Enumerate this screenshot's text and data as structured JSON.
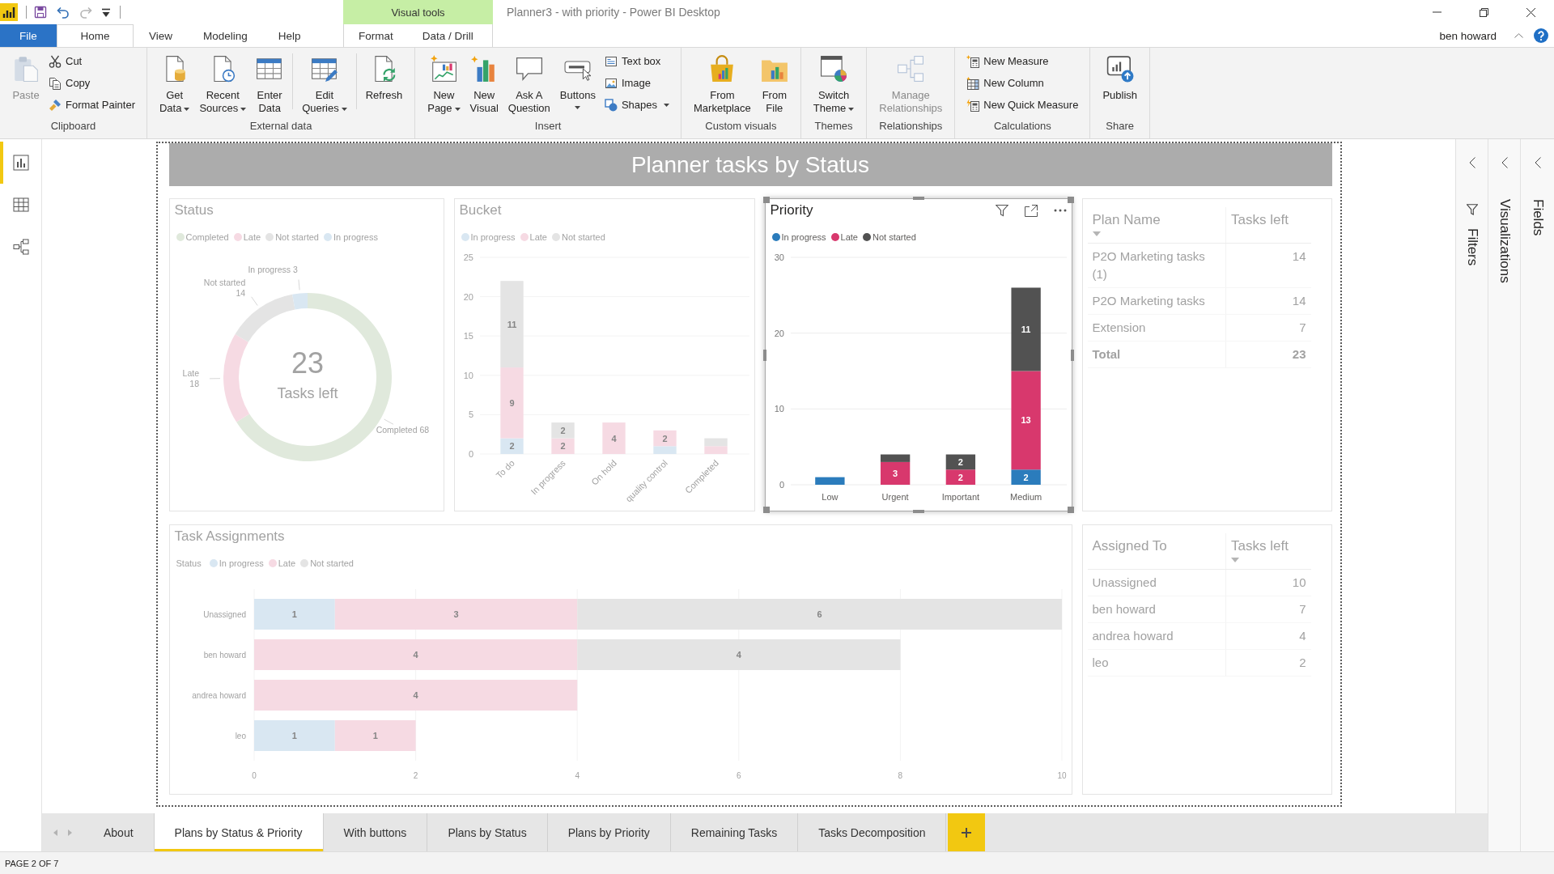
{
  "title_bar": {
    "quick_access": [
      {
        "kind": "save",
        "disabled": false
      },
      {
        "kind": "undo",
        "disabled": false
      },
      {
        "kind": "redo",
        "disabled": true
      },
      {
        "kind": "customize",
        "disabled": false
      }
    ],
    "title": "Planner3 - with priority - Power BI Desktop"
  },
  "ribbon_tabs": [
    {
      "label": "File",
      "kind": "backstage",
      "selected": false
    },
    {
      "label": "Home",
      "kind": "tab",
      "selected": true
    },
    {
      "label": "View",
      "kind": "tab",
      "selected": false
    },
    {
      "label": "Modeling",
      "kind": "tab",
      "selected": false
    },
    {
      "label": "Help",
      "kind": "tab",
      "selected": false
    }
  ],
  "context_tabs": {
    "label": "Visual tools",
    "tabs": [
      {
        "label": "Format",
        "selected": false
      },
      {
        "label": "Data / Drill",
        "selected": false
      }
    ]
  },
  "user": "ben howard",
  "ribbon": [
    {
      "label": "Clipboard",
      "items": [
        {
          "label": "Paste",
          "kind": "large",
          "disabled": true,
          "dropdown": false
        },
        {
          "label": "Cut",
          "kind": "small",
          "disabled": false,
          "dropdown": false
        },
        {
          "label": "Copy",
          "kind": "small",
          "disabled": false,
          "dropdown": false
        },
        {
          "label": "Format Painter",
          "kind": "small",
          "disabled": false,
          "dropdown": false
        }
      ]
    },
    {
      "label": "External data",
      "items": [
        {
          "label": "Get Data",
          "kind": "large",
          "disabled": false,
          "dropdown": true
        },
        {
          "label": "Recent Sources",
          "kind": "large",
          "disabled": false,
          "dropdown": true
        },
        {
          "label": "Enter Data",
          "kind": "large",
          "disabled": false,
          "dropdown": false,
          "divider_after": true
        },
        {
          "label": "Edit Queries",
          "kind": "large",
          "disabled": false,
          "dropdown": true,
          "divider_after": true
        },
        {
          "label": "Refresh",
          "kind": "large",
          "disabled": false,
          "dropdown": false
        }
      ]
    },
    {
      "label": "Insert",
      "items": [
        {
          "label": "New Page",
          "kind": "large",
          "disabled": false,
          "dropdown": true
        },
        {
          "label": "New Visual",
          "kind": "large",
          "disabled": false,
          "dropdown": false
        },
        {
          "label": "Ask A Question",
          "kind": "large",
          "disabled": false,
          "dropdown": false
        },
        {
          "label": "Buttons",
          "kind": "large",
          "disabled": false,
          "dropdown": true
        },
        {
          "label": "Text box",
          "kind": "small",
          "disabled": false,
          "dropdown": false
        },
        {
          "label": "Image",
          "kind": "small",
          "disabled": false,
          "dropdown": false
        },
        {
          "label": "Shapes",
          "kind": "small",
          "disabled": false,
          "dropdown": true
        }
      ]
    },
    {
      "label": "Custom visuals",
      "items": [
        {
          "label": "From Marketplace",
          "kind": "large",
          "disabled": false,
          "dropdown": false
        },
        {
          "label": "From File",
          "kind": "large",
          "disabled": false,
          "dropdown": false
        }
      ]
    },
    {
      "label": "Themes",
      "items": [
        {
          "label": "Switch Theme",
          "kind": "large",
          "disabled": false,
          "dropdown": true
        }
      ]
    },
    {
      "label": "Relationships",
      "items": [
        {
          "label": "Manage Relationships",
          "kind": "large",
          "disabled": true,
          "dropdown": false
        }
      ]
    },
    {
      "label": "Calculations",
      "items": [
        {
          "label": "New Measure",
          "kind": "small",
          "disabled": false,
          "dropdown": false
        },
        {
          "label": "New Column",
          "kind": "small",
          "disabled": false,
          "dropdown": false
        },
        {
          "label": "New Quick Measure",
          "kind": "small",
          "disabled": false,
          "dropdown": false
        }
      ]
    },
    {
      "label": "Share",
      "items": [
        {
          "label": "Publish",
          "kind": "large",
          "disabled": false,
          "dropdown": false
        }
      ]
    }
  ],
  "views": [
    {
      "kind": "report",
      "selected": true
    },
    {
      "kind": "data",
      "selected": false
    },
    {
      "kind": "model",
      "selected": false
    }
  ],
  "report": {
    "banner": "Planner tasks by Status",
    "visuals": [
      {
        "kind": "chart",
        "dimmed": true,
        "selected": false,
        "legend": [
          {
            "label": "Completed",
            "color": "#e0e9dc"
          },
          {
            "label": "Late",
            "color": "#f6dae3"
          },
          {
            "label": "Not started",
            "color": "#e4e4e4"
          },
          {
            "label": "In progress",
            "color": "#d9e7f2"
          }
        ],
        "center_value": "23",
        "center_label": "Tasks left",
        "chart_data": {
          "type": "donut",
          "title": "Status",
          "categories": [
            "Completed",
            "Late",
            "Not started",
            "In progress"
          ],
          "values": [
            68,
            18,
            14,
            3
          ],
          "data_labels": true
        }
      },
      {
        "kind": "chart",
        "dimmed": true,
        "selected": false,
        "chart_data": {
          "type": "bar",
          "title": "Bucket",
          "orientation": "vertical",
          "stacked": true,
          "legend": "top",
          "grid": true,
          "categories": [
            "To do",
            "In progress",
            "On hold",
            "quality control",
            "Completed"
          ],
          "series": [
            {
              "name": "In progress",
              "color": "#d9e7f2",
              "values": [
                2,
                0,
                0,
                1,
                0
              ]
            },
            {
              "name": "Late",
              "color": "#f6dae3",
              "values": [
                9,
                2,
                4,
                2,
                1
              ]
            },
            {
              "name": "Not started",
              "color": "#e4e4e4",
              "values": [
                11,
                2,
                0,
                0,
                1
              ]
            }
          ],
          "ylim": [
            0,
            25
          ],
          "yticks": [
            0,
            5,
            10,
            15,
            20,
            25
          ],
          "value_labels": [
            [
              "2",
              null,
              null,
              null,
              null
            ],
            [
              "9",
              "2",
              "4",
              "2",
              null
            ],
            [
              "11",
              "2",
              null,
              null,
              null
            ]
          ]
        }
      },
      {
        "kind": "chart",
        "dimmed": false,
        "selected": true,
        "chart_data": {
          "type": "bar",
          "title": "Priority",
          "orientation": "vertical",
          "stacked": true,
          "legend": "top",
          "grid": true,
          "categories": [
            "Low",
            "Urgent",
            "Important",
            "Medium"
          ],
          "series": [
            {
              "name": "In progress",
              "color": "#2b7cbc",
              "values": [
                1,
                0,
                0,
                2
              ]
            },
            {
              "name": "Late",
              "color": "#d8386d",
              "values": [
                0,
                3,
                2,
                13
              ]
            },
            {
              "name": "Not started",
              "color": "#525252",
              "values": [
                0,
                1,
                2,
                11
              ]
            }
          ],
          "ylim": [
            0,
            30
          ],
          "yticks": [
            0,
            10,
            20,
            30
          ],
          "value_labels": [
            [
              null,
              null,
              null,
              "2"
            ],
            [
              null,
              "3",
              "2",
              "13"
            ],
            [
              null,
              null,
              "2",
              "11"
            ]
          ]
        }
      },
      {
        "kind": "table",
        "dimmed": true,
        "selected": false,
        "columns": [
          {
            "label": "Plan Name",
            "sorted": true
          },
          {
            "label": "Tasks left",
            "sorted": false
          }
        ],
        "rows": [
          [
            "P2O Marketing tasks (1)",
            "14"
          ],
          [
            "P2O Marketing tasks",
            "14"
          ],
          [
            "Extension",
            "7"
          ]
        ],
        "total": [
          "Total",
          "23"
        ]
      },
      {
        "kind": "chart",
        "dimmed": true,
        "selected": false,
        "legend_title": "Status",
        "chart_data": {
          "type": "bar",
          "title": "Task Assignments",
          "orientation": "horizontal",
          "stacked": true,
          "legend": "top",
          "grid": true,
          "categories": [
            "Unassigned",
            "ben howard",
            "andrea howard",
            "leo"
          ],
          "series": [
            {
              "name": "In progress",
              "color": "#d9e7f2",
              "values": [
                1,
                0,
                0,
                1
              ]
            },
            {
              "name": "Late",
              "color": "#f6dae3",
              "values": [
                3,
                4,
                4,
                1
              ]
            },
            {
              "name": "Not started",
              "color": "#e4e4e4",
              "values": [
                6,
                4,
                0,
                0
              ]
            }
          ],
          "xlim": [
            0,
            10
          ],
          "xticks": [
            0,
            2,
            4,
            6,
            8,
            10
          ],
          "value_labels": [
            [
              "1",
              null,
              null,
              "1"
            ],
            [
              "3",
              "4",
              "4",
              "1"
            ],
            [
              "6",
              "4",
              null,
              null
            ]
          ]
        }
      },
      {
        "kind": "table",
        "dimmed": true,
        "selected": false,
        "columns": [
          {
            "label": "Assigned To",
            "sorted": false
          },
          {
            "label": "Tasks left",
            "sorted": true
          }
        ],
        "rows": [
          [
            "Unassigned",
            "10"
          ],
          [
            "ben howard",
            "7"
          ],
          [
            "andrea howard",
            "4"
          ],
          [
            "leo",
            "2"
          ]
        ]
      }
    ]
  },
  "panes": [
    {
      "kind": "filter",
      "label": "Filters",
      "expanded": false
    },
    {
      "kind": "plain",
      "label": "Visualizations",
      "expanded": false
    },
    {
      "kind": "plain",
      "label": "Fields",
      "expanded": false
    }
  ],
  "page_tabs": [
    {
      "label": "About",
      "selected": false
    },
    {
      "label": "Plans by Status & Priority",
      "selected": true
    },
    {
      "label": "With buttons",
      "selected": false
    },
    {
      "label": "Plans by Status",
      "selected": false
    },
    {
      "label": "Plans by Priority",
      "selected": false
    },
    {
      "label": "Remaining Tasks",
      "selected": false
    },
    {
      "label": "Tasks Decomposition",
      "selected": false
    }
  ],
  "status_bar": "PAGE 2 OF 7"
}
